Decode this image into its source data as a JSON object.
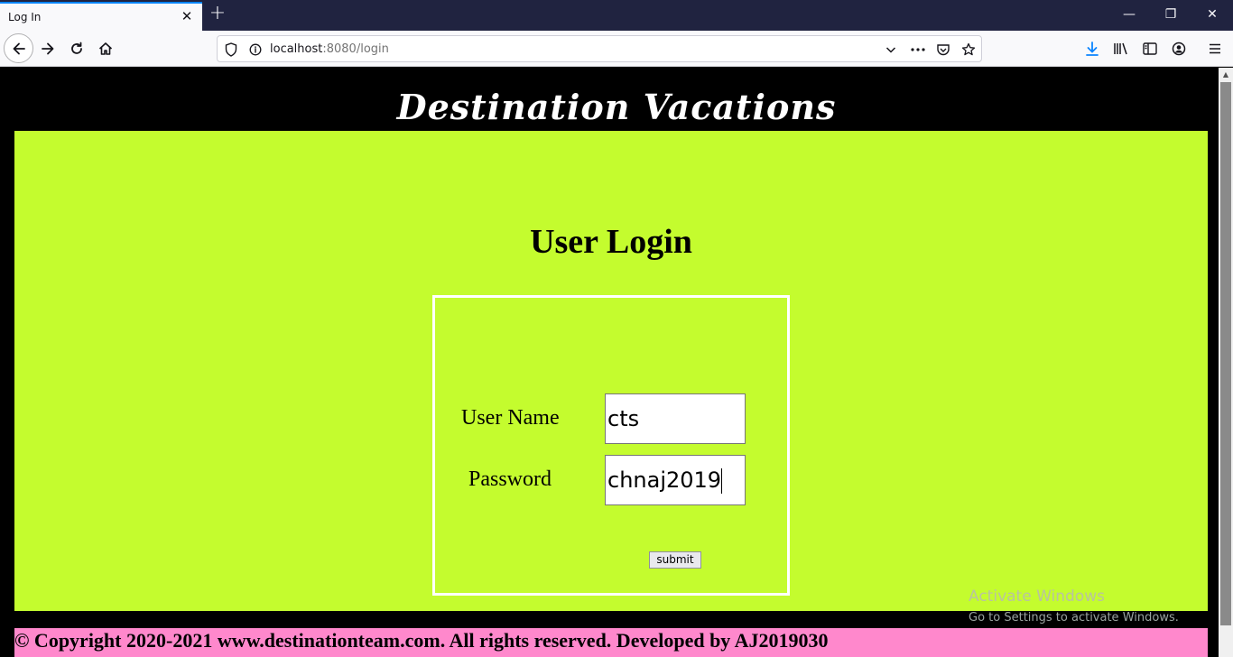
{
  "browser": {
    "tab_title": "Log In",
    "close_tab_glyph": "✕",
    "new_tab_glyph": "+",
    "url_host": "localhost",
    "url_path": ":8080/login",
    "window_controls": {
      "minimize": "—",
      "restore": "❐",
      "close": "✕"
    }
  },
  "icons": {
    "back": "back-arrow-icon",
    "forward": "forward-arrow-icon",
    "reload": "reload-icon",
    "home": "home-icon",
    "shield": "shield-icon",
    "info": "info-icon",
    "dropdown": "chevron-down-icon",
    "more": "more-icon",
    "pocket": "pocket-icon",
    "bookmark": "star-icon",
    "download": "download-icon",
    "library": "library-icon",
    "sidebar": "sidebar-icon",
    "account": "account-icon",
    "menu": "hamburger-menu-icon"
  },
  "page": {
    "site_title": "Destination Vacations",
    "heading": "User Login",
    "username_label": "User Name",
    "username_value": "cts",
    "password_label": "Password",
    "password_value": "chnaj2019",
    "submit_label": "submit",
    "footer": "© Copyright 2020-2021 www.destinationteam.com. All rights reserved. Developed by AJ2019030"
  },
  "os_overlay": {
    "activate_title": "Activate Windows",
    "activate_hint": "Go to Settings to activate Windows."
  },
  "colors": {
    "content_bg": "#c4fc2e",
    "footer_bg": "#ff88cc",
    "page_bg": "#000000",
    "accent": "#0a84ff"
  }
}
